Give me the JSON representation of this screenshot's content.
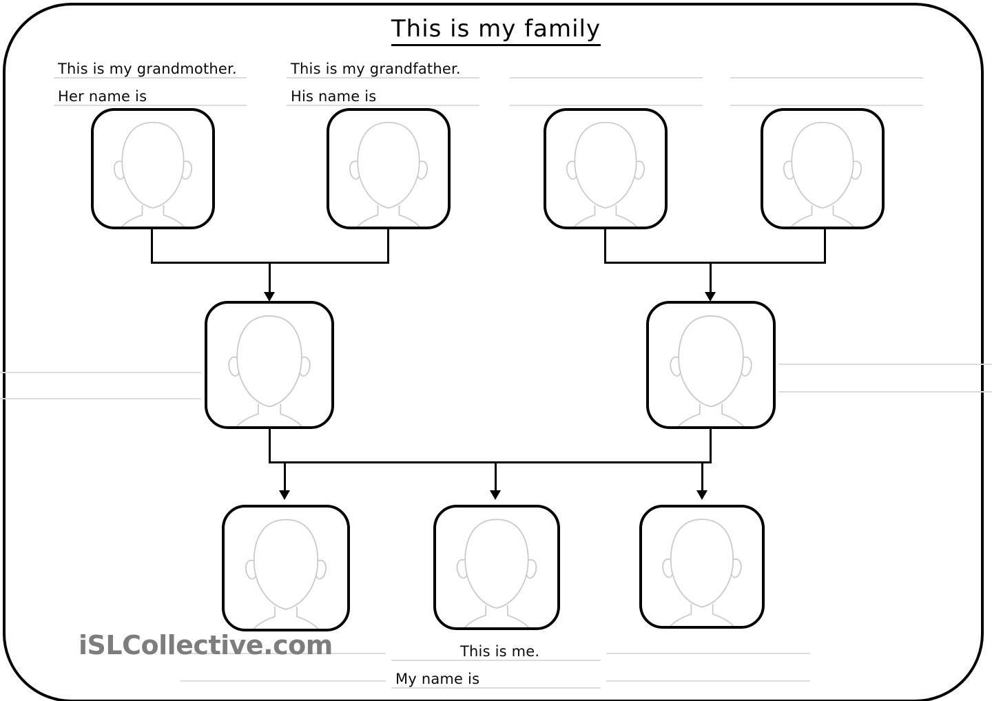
{
  "title": "This is my family",
  "watermark": "iSLCollective.com",
  "labels": {
    "grandmother_relation": "This is my grandmother.",
    "grandmother_name": "Her name is",
    "grandfather_relation": "This is my grandfather.",
    "grandfather_name": "His name is",
    "me_relation": "This is me.",
    "me_name": "My name is"
  },
  "generations": [
    {
      "name": "grandparents-row",
      "people": [
        {
          "id": "maternal-grandmother",
          "icon": "blank-face-icon",
          "relation_label": "This is my grandmother.",
          "name_label": "Her name is"
        },
        {
          "id": "maternal-grandfather",
          "icon": "blank-face-icon",
          "relation_label": "This is my grandfather.",
          "name_label": "His name is"
        },
        {
          "id": "paternal-grandmother",
          "icon": "blank-face-icon",
          "relation_label": "",
          "name_label": ""
        },
        {
          "id": "paternal-grandfather",
          "icon": "blank-face-icon",
          "relation_label": "",
          "name_label": ""
        }
      ]
    },
    {
      "name": "parents-row",
      "people": [
        {
          "id": "mother",
          "icon": "blank-face-icon",
          "relation_label": "",
          "name_label": ""
        },
        {
          "id": "father",
          "icon": "blank-face-icon",
          "relation_label": "",
          "name_label": ""
        }
      ]
    },
    {
      "name": "children-row",
      "people": [
        {
          "id": "sibling-left",
          "icon": "blank-face-icon",
          "relation_label": "",
          "name_label": ""
        },
        {
          "id": "me",
          "icon": "blank-face-icon",
          "relation_label": "This is me.",
          "name_label": "My name is"
        },
        {
          "id": "sibling-right",
          "icon": "blank-face-icon",
          "relation_label": "",
          "name_label": ""
        }
      ]
    }
  ],
  "colors": {
    "ink": "#000000",
    "rule_line": "#dcdcdc",
    "face_outline": "#c9c9c9",
    "watermark": "#7d7d7d",
    "page_background": "#ffffff"
  }
}
